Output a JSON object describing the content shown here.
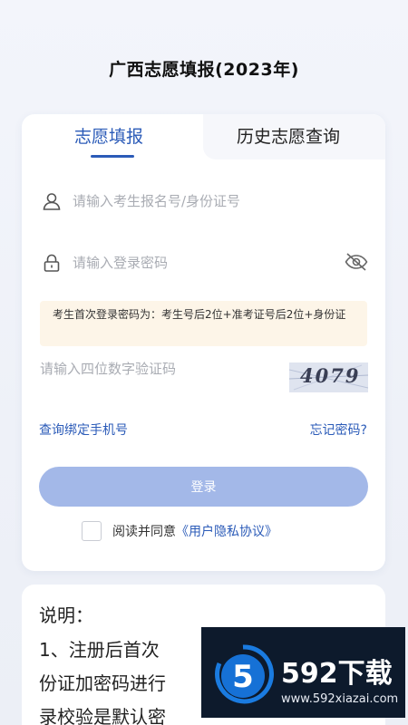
{
  "app_title": "广西志愿填报(2023年)",
  "tabs": [
    {
      "label": "志愿填报",
      "active": true
    },
    {
      "label": "历史志愿查询",
      "active": false
    }
  ],
  "login": {
    "account_placeholder": "请输入考生报名号/身份证号",
    "password_placeholder": "请输入登录密码",
    "notice": "考生首次登录密码为：考生号后2位+准考证号后2位+身份证",
    "captcha_placeholder": "请输入四位数字验证码",
    "captcha_text": "4079",
    "bind_phone_link": "查询绑定手机号",
    "forgot_password_link": "忘记密码?",
    "login_button": "登录",
    "agree_text": "阅读并同意",
    "agreement_link": "《用户隐私协议》"
  },
  "description": {
    "title": "说明：",
    "lines": [
      "1、注册后首次",
      "份证加密码进行",
      "录校验是默认密"
    ]
  },
  "watermark": {
    "brand": "592下载",
    "url": "www.592xiazai.com",
    "logo_glyph": "5"
  },
  "colors": {
    "accent": "#2b5bb8",
    "button_disabled": "#a3b8e8",
    "notice_bg": "#fdf5e8"
  }
}
